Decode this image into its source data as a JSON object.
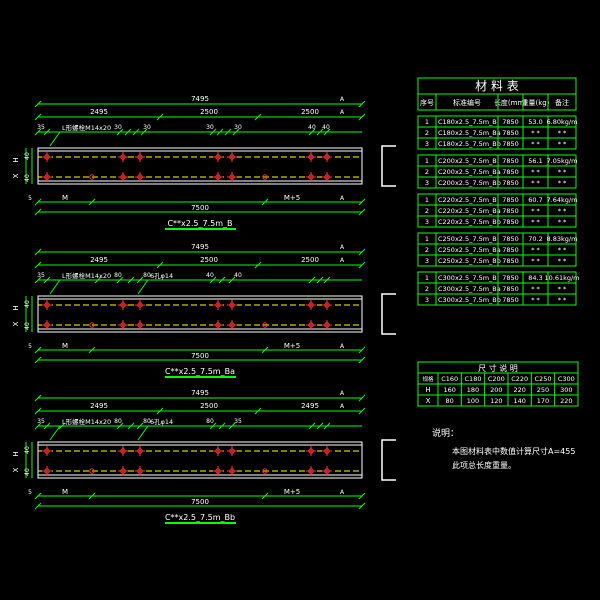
{
  "beams": [
    {
      "total": "7495",
      "spans": [
        "2495",
        "2500",
        "2500"
      ],
      "section_marks": [
        "A",
        "A"
      ],
      "hole_dims": [
        "35",
        "30",
        "30",
        "30",
        "30",
        "40",
        "40"
      ],
      "callouts": [
        "L形螺栓M14x20"
      ],
      "left_dims": [
        "H",
        "X",
        "40",
        "40"
      ],
      "bottom_labels": [
        "5",
        "M",
        "M+5",
        "A"
      ],
      "bottom_total": "7500",
      "title": "C**x2.5_7.5m_B"
    },
    {
      "total": "7495",
      "spans": [
        "2495",
        "2500",
        "2500"
      ],
      "section_marks": [
        "A",
        "A"
      ],
      "hole_dims": [
        "35",
        "80",
        "80",
        "40",
        "40"
      ],
      "callouts": [
        "L形螺栓M14x20",
        "6孔φ14"
      ],
      "left_dims": [
        "H",
        "X",
        "40",
        "40"
      ],
      "bottom_labels": [
        "5",
        "M",
        "M+5",
        "A"
      ],
      "bottom_total": "7500",
      "title": "C**x2.5_7.5m_Ba"
    },
    {
      "total": "7495",
      "spans": [
        "2495",
        "2500",
        "2495"
      ],
      "section_marks": [
        "A",
        "A"
      ],
      "hole_dims": [
        "35",
        "80",
        "80",
        "80",
        "35"
      ],
      "callouts": [
        "L形螺栓M14x20",
        "6孔φ14"
      ],
      "left_dims": [
        "H",
        "X",
        "40",
        "40"
      ],
      "bottom_labels": [
        "5",
        "M",
        "M+5",
        "A"
      ],
      "bottom_total": "7500",
      "title": "C**x2.5_7.5m_Bb"
    }
  ],
  "material_table": {
    "title": "材 料 表",
    "headers": [
      "序号",
      "标准编号",
      "长度(mm)",
      "重量(kg)",
      "备注"
    ],
    "groups": [
      [
        [
          "1",
          "C180x2.5_7.5m_B",
          "7850",
          "53.0",
          "6.80kg/m"
        ],
        [
          "2",
          "C180x2.5_7.5m_Ba",
          "7850",
          "* *",
          "* *"
        ],
        [
          "3",
          "C180x2.5_7.5m_Bb",
          "7850",
          "* *",
          "* *"
        ]
      ],
      [
        [
          "1",
          "C200x2.5_7.5m_B",
          "7850",
          "56.1",
          "7.05kg/m"
        ],
        [
          "2",
          "C200x2.5_7.5m_Ba",
          "7850",
          "* *",
          "* *"
        ],
        [
          "3",
          "C200x2.5_7.5m_Bb",
          "7850",
          "* *",
          "* *"
        ]
      ],
      [
        [
          "1",
          "C220x2.5_7.5m_B",
          "7850",
          "60.7",
          "7.64kg/m"
        ],
        [
          "2",
          "C220x2.5_7.5m_Ba",
          "7850",
          "* *",
          "* *"
        ],
        [
          "3",
          "C220x2.5_7.5m_Bb",
          "7850",
          "* *",
          "* *"
        ]
      ],
      [
        [
          "1",
          "C250x2.5_7.5m_B",
          "7850",
          "70.2",
          "8.83kg/m"
        ],
        [
          "2",
          "C250x2.5_7.5m_Ba",
          "7850",
          "* *",
          "* *"
        ],
        [
          "3",
          "C250x2.5_7.5m_Bb",
          "7850",
          "* *",
          "* *"
        ]
      ],
      [
        [
          "1",
          "C300x2.5_7.5m_B",
          "7850",
          "84.3",
          "10.61kg/m"
        ],
        [
          "2",
          "C300x2.5_7.5m_Ba",
          "7850",
          "* *",
          "* *"
        ],
        [
          "3",
          "C300x2.5_7.5m_Bb",
          "7850",
          "* *",
          "* *"
        ]
      ]
    ]
  },
  "dim_table": {
    "title": "尺 寸 说 明",
    "corner": "规格",
    "columns": [
      "C160",
      "C180",
      "C200",
      "C220",
      "C250",
      "C300"
    ],
    "rows": [
      {
        "label": "H",
        "values": [
          "160",
          "180",
          "200",
          "220",
          "250",
          "300"
        ]
      },
      {
        "label": "X",
        "values": [
          "80",
          "100",
          "120",
          "140",
          "170",
          "220"
        ]
      }
    ]
  },
  "notes": {
    "title": "说明：",
    "lines": [
      "本图材料表中数值计算尺寸A=455",
      "此项总长度重量。"
    ]
  },
  "colors": {
    "background": "#000000",
    "dimension": "#00ff00",
    "text": "#ffffff",
    "outline": "#ffffff",
    "centerline": "#ffff00",
    "holes": "#ff3333",
    "title_underline": "#00ff00",
    "table_lines": "#00ff00"
  }
}
